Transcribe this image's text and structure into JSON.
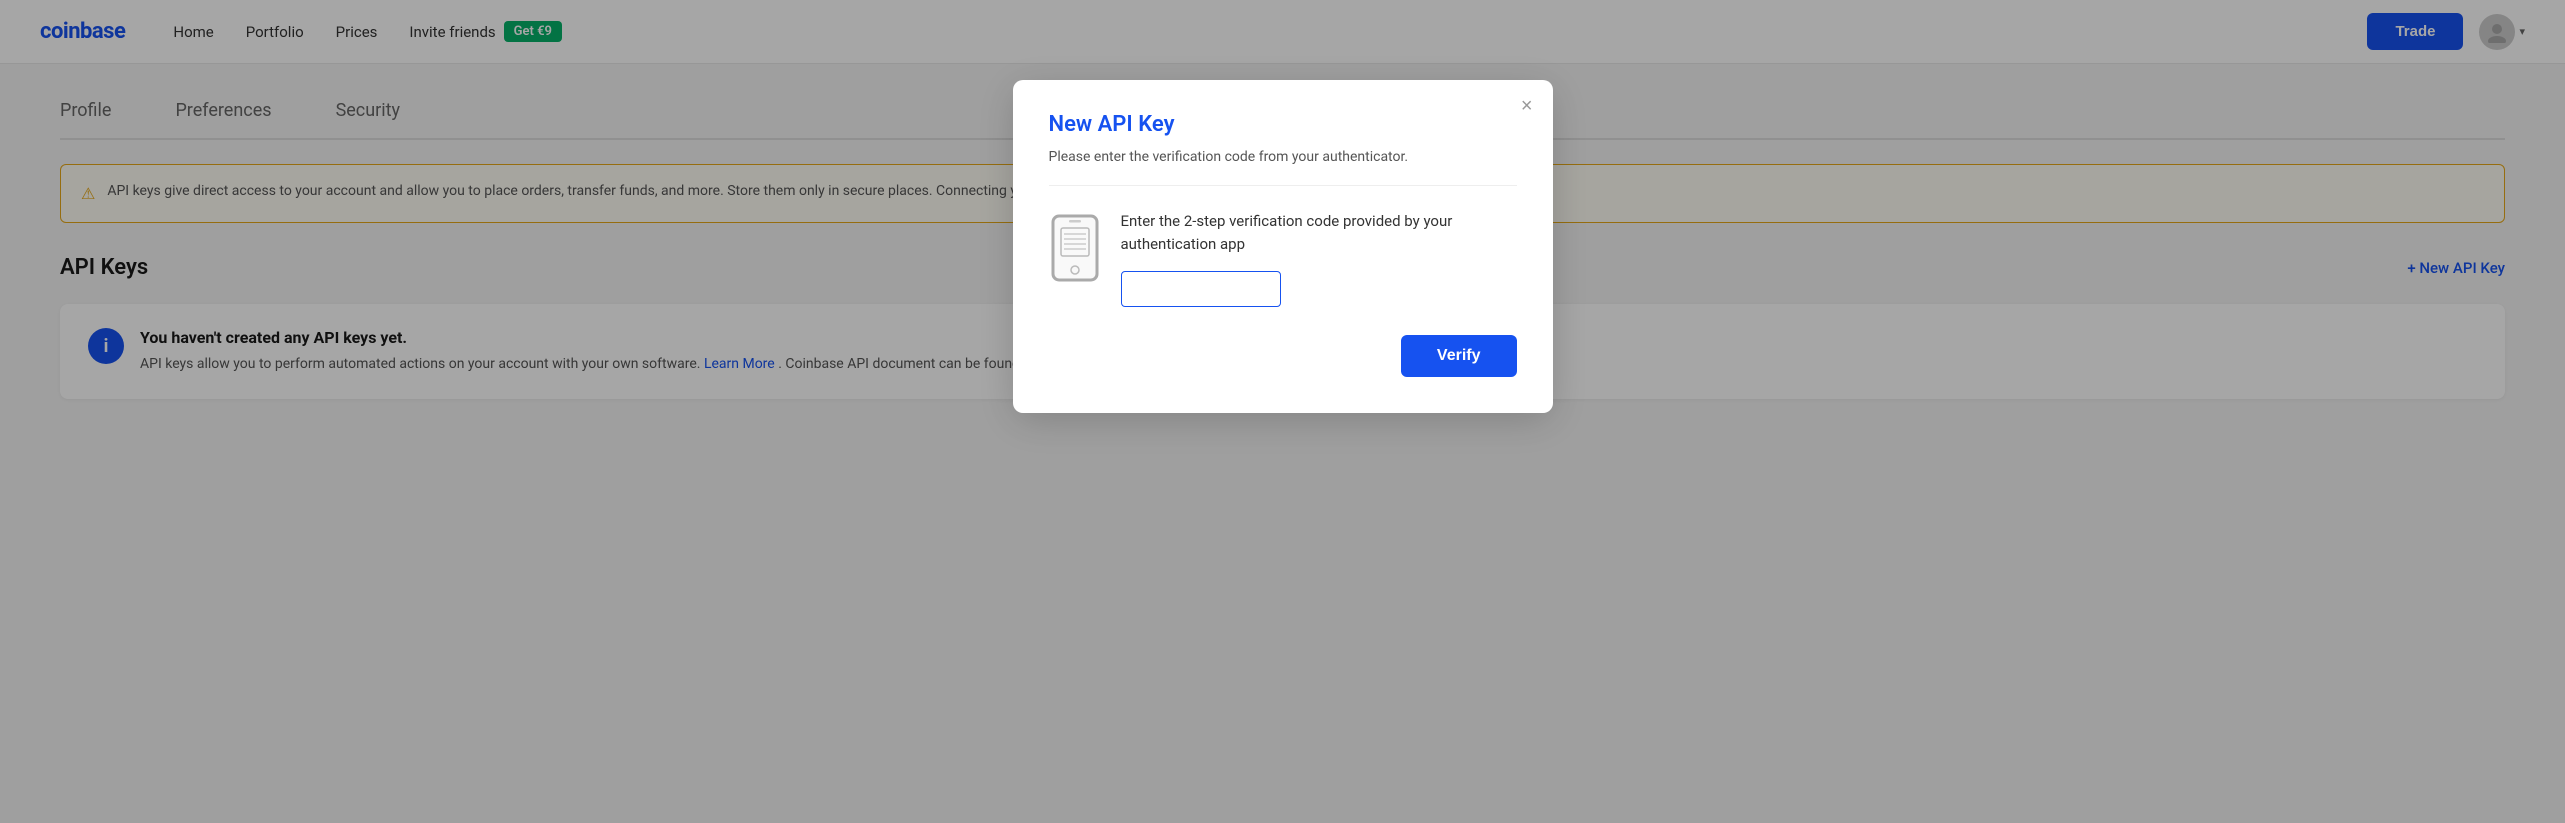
{
  "header": {
    "logo": "coinbase",
    "nav": {
      "home": "Home",
      "portfolio": "Portfolio",
      "prices": "Prices",
      "invite_friends": "Invite friends",
      "invite_badge": "Get €9",
      "trade": "Trade"
    }
  },
  "tabs": {
    "profile": "Profile",
    "preferences": "Preferences",
    "security": "Security"
  },
  "warning": {
    "text": "API keys give direct access to your account and allow you to place orders, transfer funds, and more. Store them only in secure places. Connecting your keys to"
  },
  "api_section": {
    "title": "API Keys",
    "new_button": "+ New API Key"
  },
  "info_box": {
    "headline": "You haven't created any API keys yet.",
    "body": "API keys allow you to perform automated actions on your account with your own software.",
    "link_text": "Learn More",
    "body2": ". Coinbase API document can be found"
  },
  "modal": {
    "title": "New API Key",
    "subtitle": "Please enter the verification code from your authenticator.",
    "body_text": "Enter the 2-step verification code provided by your authentication app",
    "input_placeholder": "",
    "verify_button": "Verify",
    "close_label": "×"
  }
}
